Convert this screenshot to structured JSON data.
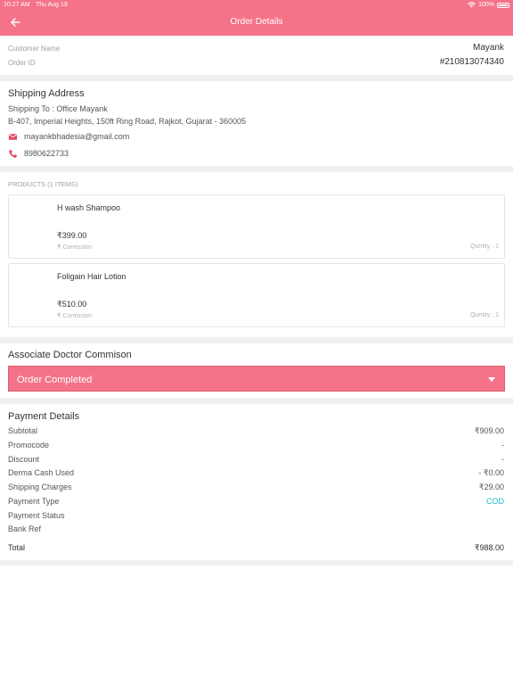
{
  "status_bar": {
    "time": "10:27 AM",
    "date": "Thu Aug 19",
    "battery": "100%"
  },
  "header": {
    "title": "Order Details"
  },
  "order": {
    "customer_name_label": "Customer Name",
    "customer_name": "Mayank",
    "order_id_label": "Order ID",
    "order_id": "#210813074340"
  },
  "shipping": {
    "title": "Shipping Address",
    "shipping_to": "Shipping To : Office Mayank",
    "address": "B-407, Imperial Heights, 150ft Ring Road, Rajkot, Gujarat - 360005",
    "email": "mayankbhadesia@gmail.com",
    "phone": "8980622733"
  },
  "products": {
    "header": "PRODUCTS (1 ITEMS)",
    "items": [
      {
        "name": "H wash Shampoo",
        "price": "₹399.00",
        "commission": "₹ Comission",
        "quantity": "Quntity : 1"
      },
      {
        "name": "Foligain Hair Lotion",
        "price": "₹510.00",
        "commission": "₹ Comission",
        "quantity": "Quntity : 1"
      }
    ]
  },
  "doctor": {
    "title": "Associate Doctor Commison",
    "status_selected": "Order Completed"
  },
  "payment": {
    "title": "Payment Details",
    "rows": [
      {
        "label": "Subtotal",
        "value": "₹909.00"
      },
      {
        "label": "Promocode",
        "value": "-"
      },
      {
        "label": "Discount",
        "value": "-"
      },
      {
        "label": "Derma Cash Used",
        "value": "- ₹0.00"
      },
      {
        "label": "Shipping Charges",
        "value": "₹29.00"
      },
      {
        "label": "Payment Type",
        "value": "COD"
      },
      {
        "label": "Payment Status",
        "value": ""
      },
      {
        "label": "Bank Ref",
        "value": ""
      }
    ],
    "total_label": "Total",
    "total_value": "₹988.00"
  },
  "colors": {
    "accent": "#f47389",
    "cod": "#1fb8c8"
  }
}
